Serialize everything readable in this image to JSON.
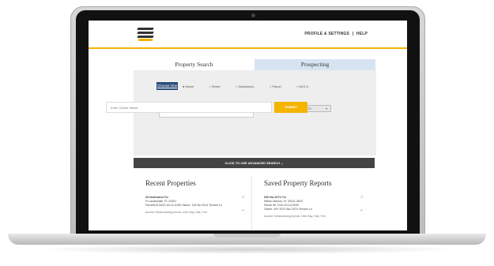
{
  "header": {
    "links": [
      "PROFILE & SETTINGS",
      "|",
      "HELP"
    ]
  },
  "tabs": {
    "search": "Property Search",
    "prospecting": "Prospecting"
  },
  "search_panel": {
    "choose_button": "Choose One",
    "options": [
      "Name",
      "Street",
      "Subdivision",
      "Parcel",
      "MLS #"
    ],
    "county_value": "x Okaloosa County, FL",
    "or_label": "or",
    "saved_search": "SAVED RESULTS",
    "owner_placeholder": "Enter Owner Name...",
    "submit_label": "SUBMIT"
  },
  "advanced_bar": "CLICK TO USE ADVANCED SEARCH  ⌄",
  "recent": {
    "title": "Recent Properties",
    "addr1": "25 Northwind Ter",
    "addr2": "Ft Lauderdale, FL 33301",
    "details": "Parcel#10-5422-00-12-0150  Owner: 125 Ne 2014 Terrace Ln",
    "footer": "Accent: Nextmeaning trends: Inter Bay, Salt, Fort"
  },
  "saved": {
    "title": "Saved Property Reports",
    "addr1": "535 Nw 20Th Ter",
    "addr2": "Wilton Manors, FL 33311-3623",
    "details": "Parcel 50-7244-00-10-5030",
    "details2": "Owner: 507 5374 Nw 20Th Terrace Ln",
    "footer": "Accent: Nextmeaning trends: Inter Bay, Salt, Fort"
  },
  "icons": {
    "star": "star-icon",
    "arrow": "arrow-right-icon"
  },
  "colors": {
    "accent": "#f4b400",
    "button_blue": "#2a4d7a",
    "tab_inactive": "#d6e4f2",
    "adv_bar": "#444444"
  }
}
